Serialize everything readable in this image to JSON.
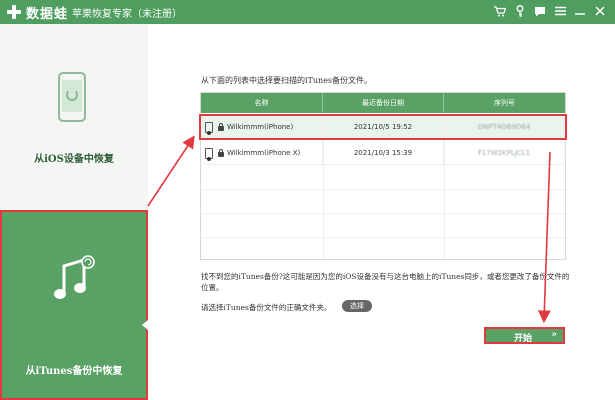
{
  "app": {
    "name": "数据蛙",
    "window_title": "苹果恢复专家（未注册）"
  },
  "titlebar_icons": [
    "cart-icon",
    "key-icon",
    "chat-icon",
    "menu-icon",
    "minimize-icon",
    "close-icon"
  ],
  "sidebar": {
    "items": [
      {
        "label": "从iOS设备中恢复",
        "icon": "phone-sync-icon",
        "active": false
      },
      {
        "label": "从iTunes备份中恢复",
        "icon": "music-note-icon",
        "active": true
      }
    ]
  },
  "main": {
    "instruction": "从下面的列表中选择要扫描的iTunes备份文件。",
    "table": {
      "headers": [
        "名称",
        "最近备份日期",
        "序列号"
      ],
      "rows": [
        {
          "name": "Wilkimmm(iPhone)",
          "date": "2021/10/5 19:52",
          "serial": "DNPT4GB9D64",
          "selected": true
        },
        {
          "name": "Wilkimmm(iPhone X)",
          "date": "2021/10/3 15:39",
          "serial": "F17W2KPLJCL1",
          "selected": false
        }
      ]
    },
    "note": "找不到您的iTunes备份?这可能是因为您的iOS设备没有与这台电脑上的iTunes同步，或者您更改了备份文件的位置。",
    "choose_label": "请选择iTunes备份文件的正确文件夹。",
    "browse_button": "选择",
    "start_button": "开始",
    "start_chevron": "»"
  },
  "colors": {
    "brand_green": "#5aa166",
    "titlebar_green": "#4f9d5f",
    "annotation_red": "#e0393f"
  }
}
